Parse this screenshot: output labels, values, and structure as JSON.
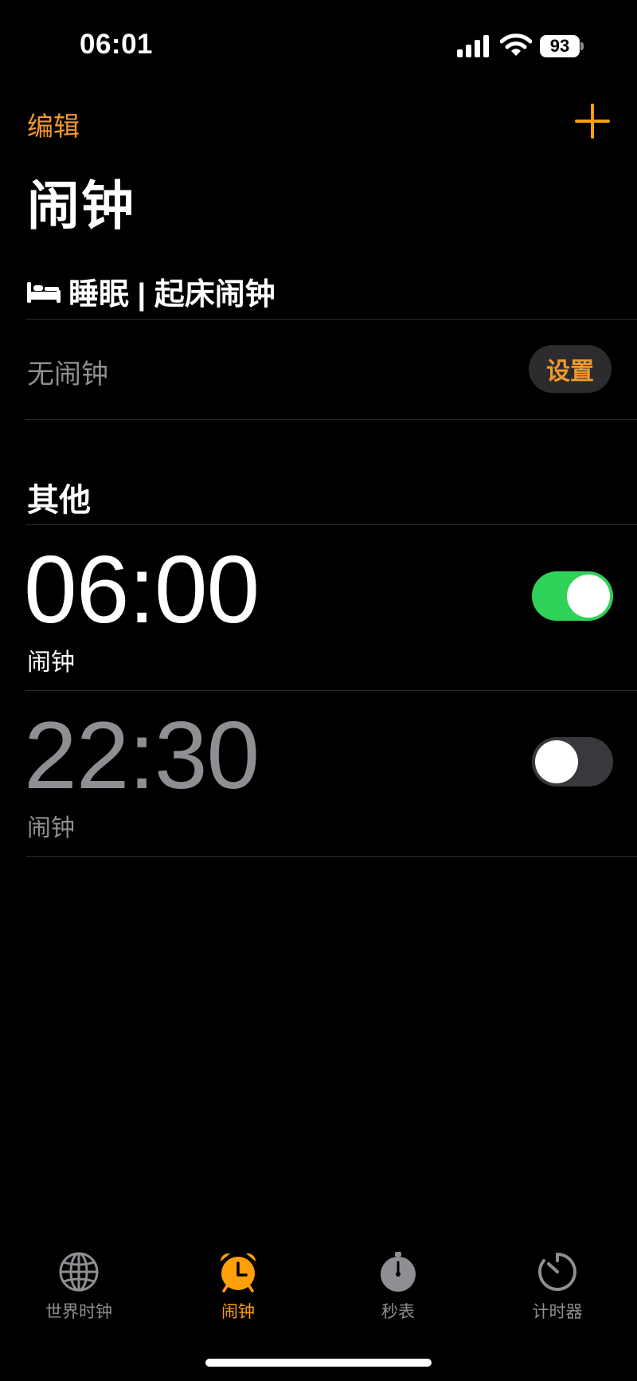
{
  "status_bar": {
    "time": "06:01",
    "battery": "93",
    "signal_icon": "cellular-signal-icon",
    "wifi_icon": "wifi-icon"
  },
  "nav": {
    "edit_label": "编辑",
    "add_icon": "plus-icon"
  },
  "title": "闹钟",
  "sleep": {
    "header": "睡眠 | 起床闹钟",
    "icon": "bed-icon",
    "empty_text": "无闹钟",
    "setup_label": "设置"
  },
  "other": {
    "header": "其他"
  },
  "alarms": [
    {
      "time": "06:00",
      "label": "闹钟",
      "enabled": true
    },
    {
      "time": "22:30",
      "label": "闹钟",
      "enabled": false
    }
  ],
  "tabs": [
    {
      "label": "世界时钟",
      "icon": "globe-icon",
      "active": false
    },
    {
      "label": "闹钟",
      "icon": "alarm-clock-icon",
      "active": true
    },
    {
      "label": "秒表",
      "icon": "stopwatch-icon",
      "active": false
    },
    {
      "label": "计时器",
      "icon": "timer-icon",
      "active": false
    }
  ],
  "colors": {
    "accent": "#ff9f0a",
    "toggle_on": "#30d158",
    "background": "#000000"
  }
}
